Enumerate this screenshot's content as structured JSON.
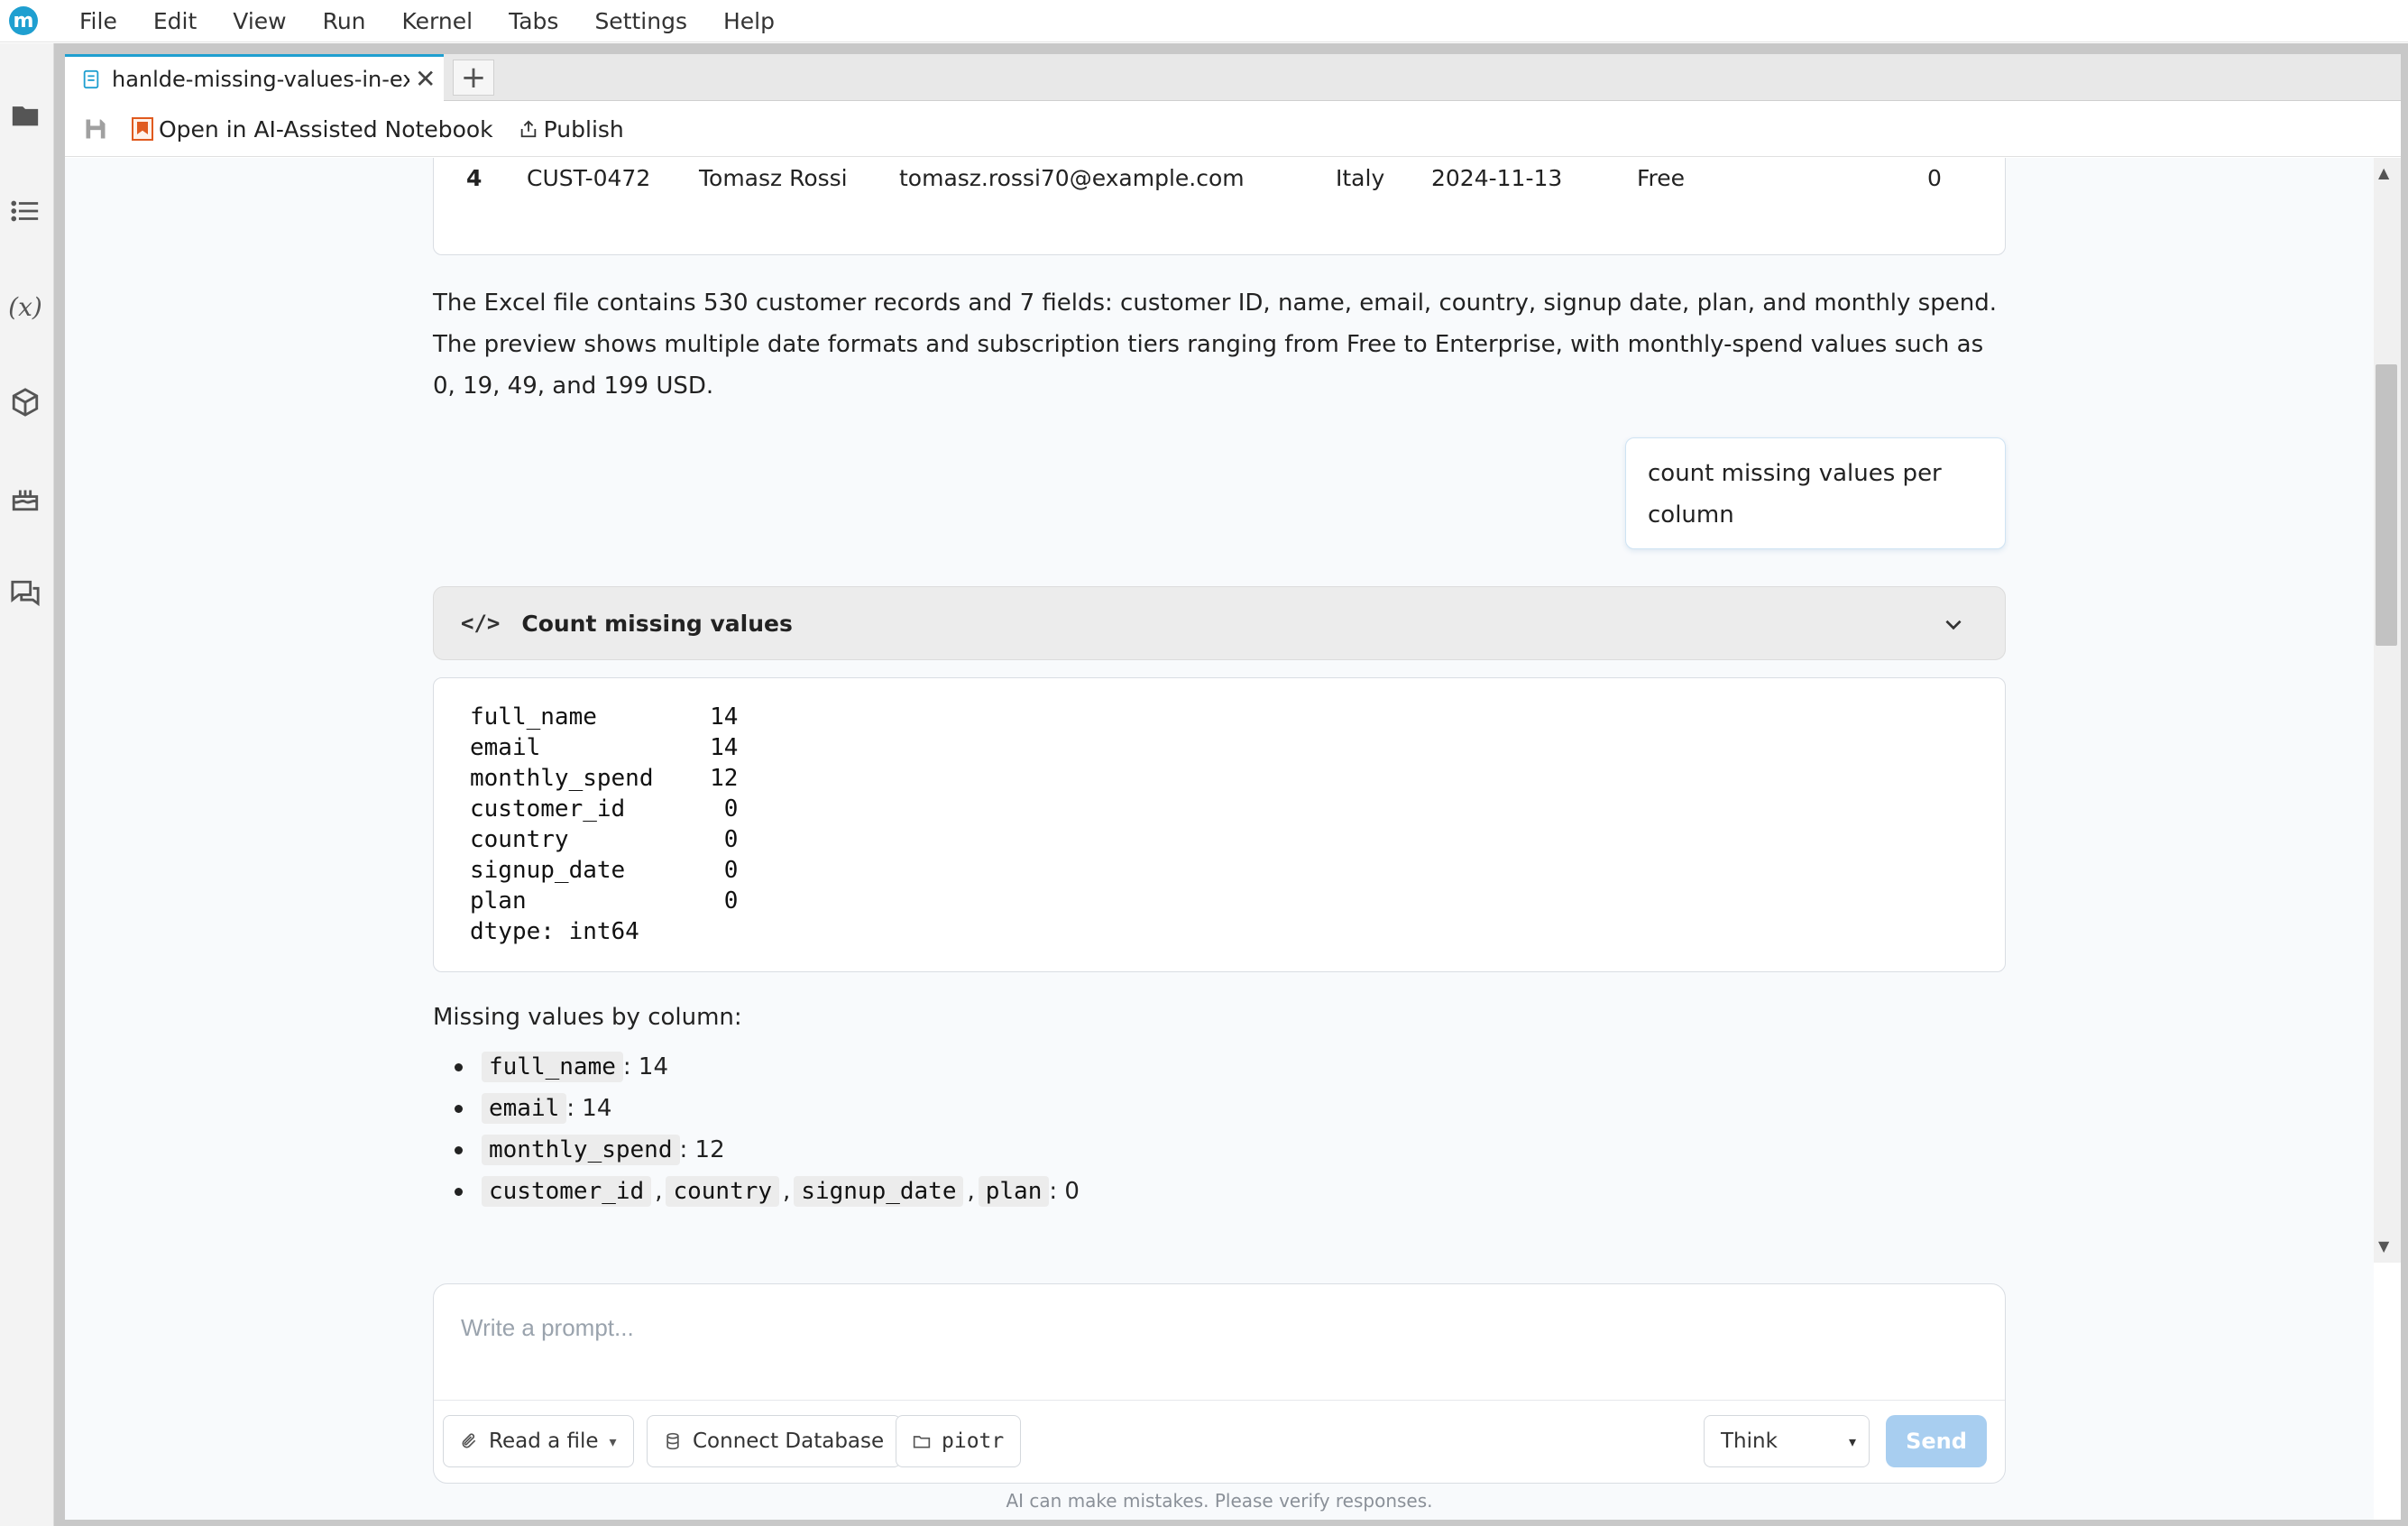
{
  "menubar": {
    "logo_letter": "m",
    "items": [
      "File",
      "Edit",
      "View",
      "Run",
      "Kernel",
      "Tabs",
      "Settings",
      "Help"
    ]
  },
  "sidebar": {
    "icons": [
      "folder-icon",
      "table-of-contents-icon",
      "variables-icon",
      "extensions-icon",
      "kernel-cake-icon",
      "chat-icon"
    ],
    "variables_glyph": "(x)"
  },
  "tabs": {
    "active_title": "hanlde-missing-values-in-exc",
    "close_glyph": "✕",
    "new_tab_glyph": "+"
  },
  "toolbar": {
    "ai_notebook_label": "Open in AI-Assisted Notebook",
    "publish_label": "Publish"
  },
  "preview_table": {
    "row": {
      "index": "4",
      "customer_id": "CUST-0472",
      "full_name": "Tomasz Rossi",
      "email": "tomasz.rossi70@example.com",
      "country": "Italy",
      "signup_date": "2024-11-13",
      "plan": "Free",
      "monthly_spend": "0"
    }
  },
  "assistant": {
    "summary_line1": "The Excel file contains 530 customer records and 7 fields: customer ID, name, email, country, signup date, plan, and monthly spend.",
    "summary_line2": "The preview shows multiple date formats and subscription tiers ranging from Free to Enterprise, with monthly-spend values such as",
    "summary_line3": "0, 19, 49, and 199 USD."
  },
  "user_message": {
    "text": "count missing values per column"
  },
  "code_block": {
    "glyph": "</>",
    "title": "Count missing values"
  },
  "output": {
    "lines": [
      "full_name        14",
      "email            14",
      "monthly_spend    12",
      "customer_id       0",
      "country           0",
      "signup_date       0",
      "plan              0",
      "dtype: int64"
    ]
  },
  "result": {
    "heading": "Missing values by column:",
    "bullets": [
      {
        "codes": [
          "full_name"
        ],
        "value": ": 14"
      },
      {
        "codes": [
          "email"
        ],
        "value": ": 14"
      },
      {
        "codes": [
          "monthly_spend"
        ],
        "value": ": 12"
      },
      {
        "codes": [
          "customer_id",
          "country",
          "signup_date",
          "plan"
        ],
        "value": ": 0"
      }
    ],
    "separator": ","
  },
  "composer": {
    "placeholder": "Write a prompt...",
    "read_file_label": "Read a file",
    "connect_db_label": "Connect Database",
    "folder_label": "piotr",
    "mode_value": "Think",
    "send_label": "Send",
    "caret": "▾",
    "disclaimer": "AI can make mistakes. Please verify responses."
  },
  "scroll": {
    "up_glyph": "▲",
    "down_glyph": "▼"
  }
}
